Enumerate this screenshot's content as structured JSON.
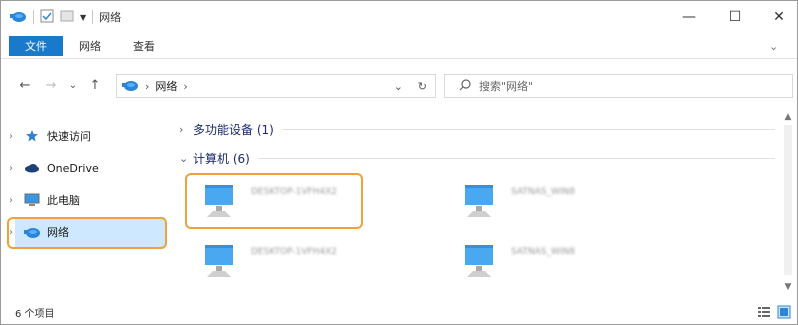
{
  "window": {
    "title": "网络",
    "qa_dropdown": "▼",
    "minimize": "—",
    "maximize": "☐",
    "close": "✕"
  },
  "ribbon": {
    "tabs": [
      {
        "label": "文件"
      },
      {
        "label": "网络"
      },
      {
        "label": "查看"
      }
    ],
    "expand": "⌄"
  },
  "address": {
    "back": "←",
    "forward": "→",
    "recent": "⌄",
    "up": "↑",
    "sep": "›",
    "crumb": "网络",
    "crumb_sep": "›",
    "dropdown": "⌄",
    "refresh": "↻"
  },
  "search": {
    "placeholder": "搜索\"网络\""
  },
  "nav": {
    "items": [
      {
        "label": "快速访问",
        "chev": "›"
      },
      {
        "label": "OneDrive",
        "chev": "›"
      },
      {
        "label": "此电脑",
        "chev": "›"
      },
      {
        "label": "网络",
        "chev": "›"
      }
    ]
  },
  "groups": [
    {
      "chev": "›",
      "label": "多功能设备 (1)"
    },
    {
      "chev": "⌄",
      "label": "计算机 (6)"
    }
  ],
  "computers": [
    {
      "name": "DESKTOP-1VFH4X2"
    },
    {
      "name": "SATNAS_WIN8"
    },
    {
      "name": "DESKTOP-1VFH4X2"
    },
    {
      "name": "SATNAS_WIN8"
    }
  ],
  "scroll": {
    "up": "▲",
    "down": "▼"
  },
  "status": {
    "count": "6 个项目"
  },
  "colors": {
    "accent": "#1979ca",
    "highlight": "#f0a23a",
    "nav_selected": "#cde8ff"
  }
}
